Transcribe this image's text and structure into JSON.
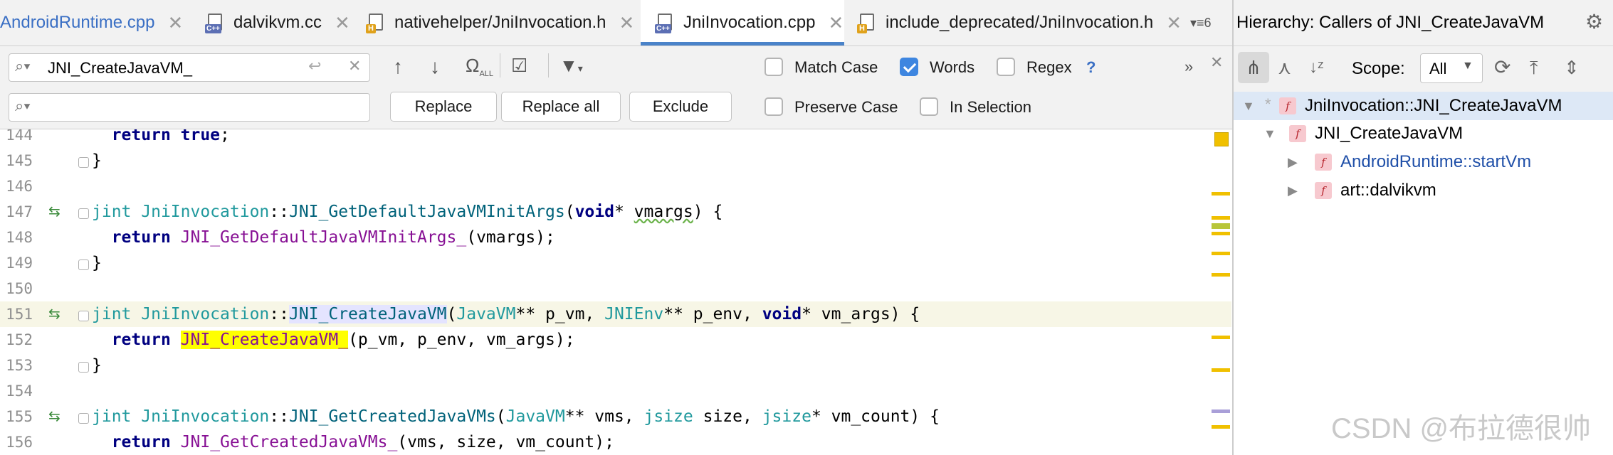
{
  "colors": {
    "accent": "#4a83c9",
    "checkbox_on": "#3e86e0",
    "search_highlight": "#ffff00",
    "keyword": "#000080",
    "function": "#00627a",
    "type": "#20999d",
    "current_line": "#f7f6e6",
    "badge_fn": "#f7c9cf"
  },
  "tabs": [
    {
      "label": "AndroidRuntime.cpp",
      "icon": "none",
      "active": false
    },
    {
      "label": "dalvikvm.cc",
      "icon": "cpp-file-icon",
      "active": false
    },
    {
      "label": "nativehelper/JniInvocation.h",
      "icon": "h-file-icon",
      "active": false
    },
    {
      "label": "JniInvocation.cpp",
      "icon": "cpp-file-icon",
      "active": true
    },
    {
      "label": "include_deprecated/JniInvocation.h",
      "icon": "h-file-icon",
      "active": false
    }
  ],
  "tab_overflow": {
    "count": "6"
  },
  "find": {
    "search_value": "JNI_CreateJavaVM_",
    "replace_placeholder": "",
    "replace_label": "Replace",
    "replace_all_label": "Replace all",
    "exclude_label": "Exclude",
    "options": {
      "match_case": {
        "label": "Match Case",
        "checked": false
      },
      "words": {
        "label": "Words",
        "checked": true
      },
      "regex": {
        "label": "Regex",
        "checked": false
      },
      "preserve_case": {
        "label": "Preserve Case",
        "checked": false
      },
      "in_selection": {
        "label": "In Selection",
        "checked": false
      }
    },
    "regex_help": "?"
  },
  "editor": {
    "lines": [
      {
        "num": "144",
        "text": "  return true;"
      },
      {
        "num": "145",
        "text": "}"
      },
      {
        "num": "146",
        "text": ""
      },
      {
        "num": "147",
        "text": "jint JniInvocation::JNI_GetDefaultJavaVMInitArgs(void* vmargs) {"
      },
      {
        "num": "148",
        "text": "  return JNI_GetDefaultJavaVMInitArgs_(vmargs);"
      },
      {
        "num": "149",
        "text": "}"
      },
      {
        "num": "150",
        "text": ""
      },
      {
        "num": "151",
        "text": "jint JniInvocation::JNI_CreateJavaVM(JavaVM** p_vm, JNIEnv** p_env, void* vm_args) {"
      },
      {
        "num": "152",
        "text": "  return JNI_CreateJavaVM_(p_vm, p_env, vm_args);"
      },
      {
        "num": "153",
        "text": "}"
      },
      {
        "num": "154",
        "text": ""
      },
      {
        "num": "155",
        "text": "jint JniInvocation::JNI_GetCreatedJavaVMs(JavaVM** vms, jsize size, jsize* vm_count) {"
      },
      {
        "num": "156",
        "text": "  return JNI_GetCreatedJavaVMs_(vms, size, vm_count);"
      }
    ],
    "current_line": "151",
    "search_match": "JNI_CreateJavaVM_"
  },
  "hierarchy": {
    "title": "Hierarchy:  Callers of JNI_CreateJavaVM",
    "scope_label": "Scope:",
    "scope_value": "All",
    "tree": [
      {
        "label": "JniInvocation::JNI_CreateJavaVM",
        "badge": "f",
        "level": 0,
        "expanded": true
      },
      {
        "label": "JNI_CreateJavaVM",
        "badge": "f",
        "level": 1,
        "expanded": true
      },
      {
        "label": "AndroidRuntime::startVm",
        "badge": "f",
        "level": 2,
        "expanded": false
      },
      {
        "label": "art::dalvikvm",
        "badge": "f",
        "level": 2,
        "expanded": false
      }
    ]
  },
  "watermark": "CSDN @布拉德很帅"
}
